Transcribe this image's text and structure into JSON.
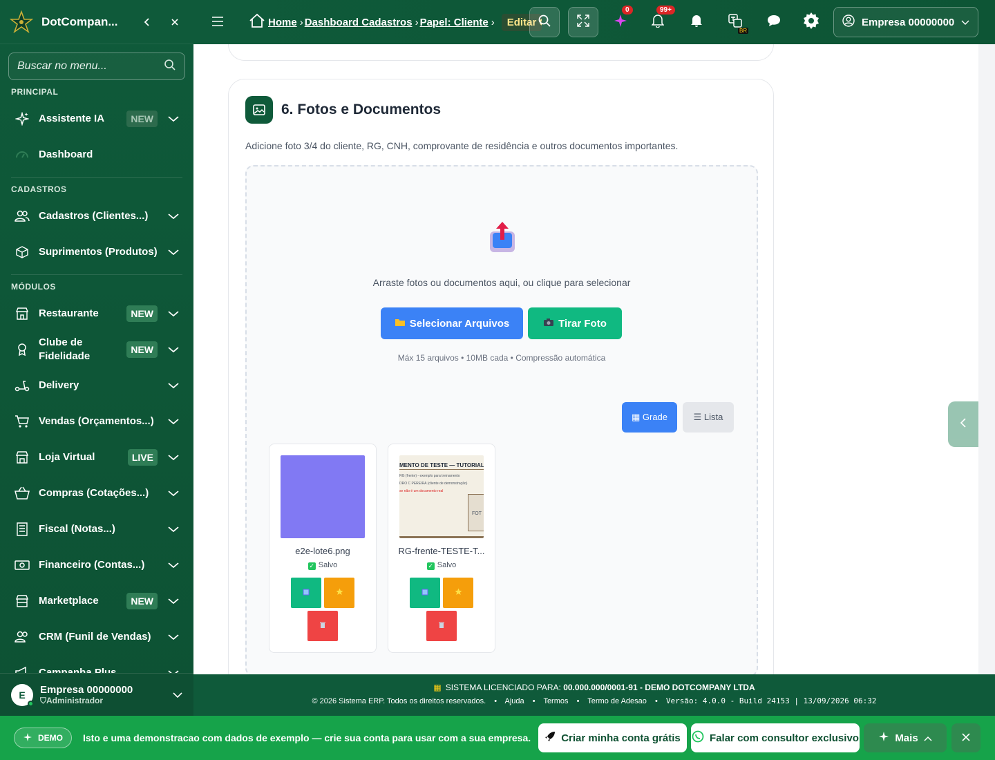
{
  "sidebar": {
    "brand": "DotCompan...",
    "search_placeholder": "Buscar no menu...",
    "sections": {
      "principal": "PRINCIPAL",
      "cadastros": "CADASTROS",
      "modulos": "MÓDULOS"
    },
    "items": [
      {
        "label": "Assistente IA",
        "badge": "NEW",
        "icon": "sparkles-icon"
      },
      {
        "label": "Dashboard",
        "icon": "gauge-icon"
      },
      {
        "label": "Cadastros (Clientes...)",
        "icon": "users-icon"
      },
      {
        "label": "Suprimentos (Produtos)",
        "icon": "box-icon"
      },
      {
        "label": "Restaurante",
        "badge": "NEW",
        "icon": "store-icon"
      },
      {
        "label": "Clube de Fidelidade",
        "badge": "NEW",
        "icon": "award-icon"
      },
      {
        "label": "Delivery",
        "icon": "scooter-icon"
      },
      {
        "label": "Vendas (Orçamentos...)",
        "icon": "cart-icon"
      },
      {
        "label": "Loja Virtual",
        "badge": "LIVE",
        "icon": "shop-icon"
      },
      {
        "label": "Compras (Cotações...)",
        "icon": "basket-icon"
      },
      {
        "label": "Fiscal (Notas...)",
        "icon": "receipt-icon"
      },
      {
        "label": "Financeiro (Contas...)",
        "icon": "money-icon"
      },
      {
        "label": "Marketplace",
        "badge": "NEW",
        "icon": "market-icon"
      },
      {
        "label": "CRM (Funil de Vendas)",
        "icon": "users-icon"
      },
      {
        "label": "Campanha Plus",
        "icon": "megaphone-icon"
      }
    ],
    "user": {
      "initial": "E",
      "name": "Empresa 00000000",
      "role": "Administrador"
    }
  },
  "topbar": {
    "breadcrumb": [
      "Home",
      "Dashboard Cadastros",
      "Papel: Cliente",
      "Editar Cliente"
    ],
    "notifications_ai": "0",
    "notifications": "99+",
    "lang_badge": "BR",
    "company": "Empresa 00000000"
  },
  "card": {
    "title": "6. Fotos e Documentos",
    "description": "Adicione foto 3/4 do cliente, RG, CNH, comprovante de residência e outros documentos importantes.",
    "drop_text": "Arraste fotos ou documentos aqui, ou clique para selecionar",
    "select_button": "Selecionar Arquivos",
    "camera_button": "Tirar Foto",
    "hint": "Máx 15 arquivos • 10MB cada • Compressão automática",
    "view_grid": "▦ Grade",
    "view_list": "☰ Lista",
    "files": [
      {
        "name": "e2e-lote6.png",
        "status": "Salvo",
        "thumb_color": "#8179f3"
      },
      {
        "name": "RG-frente-TESTE-T...",
        "status": "Salvo",
        "thumb_color": "#f3efe4",
        "doc_lines": [
          "MENTO DE TESTE — TUTORIAL",
          "RG (frente) - exemplo para treinamento",
          "DRO C PEREIRA (cliente de demonstração)",
          "se não é um documento real",
          "FOT"
        ]
      }
    ]
  },
  "footer": {
    "license_label": "SISTEMA LICENCIADO PARA:",
    "license_value": "00.000.000/0001-91 - DEMO DOTCOMPANY LTDA",
    "copyright": "© 2026 Sistema ERP. Todos os direitos reservados.",
    "links": [
      "Ajuda",
      "Termos",
      "Termo de Adesao"
    ],
    "version": "Versão: 4.0.0 - Build 24153 | 13/09/2026 06:32"
  },
  "demo_bar": {
    "pill": "DEMO",
    "message_pre": "Isto e uma ",
    "message_bold": "demonstracao",
    "message_post": " com dados de exemplo — crie sua conta para usar com a sua empresa.",
    "create_account": "Criar minha conta grátis",
    "consultant": "Falar com consultor exclusivo",
    "more": "Mais"
  },
  "colors": {
    "sidebar": "#0f5a3a",
    "primary_blue": "#3b82f6",
    "success_green": "#10b981",
    "warning": "#f59e0b",
    "danger": "#ef4444",
    "demo_bar": "#16a34a"
  }
}
